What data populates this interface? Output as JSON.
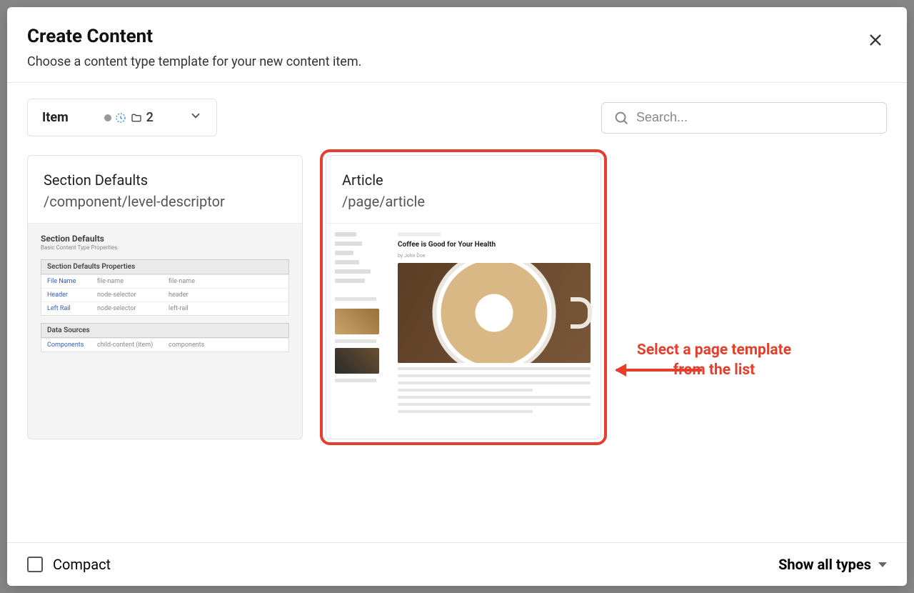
{
  "modal": {
    "title": "Create Content",
    "subtitle": "Choose a content type template for your new content item."
  },
  "toolbar": {
    "item_label": "Item",
    "item_count": "2",
    "search_placeholder": "Search..."
  },
  "cards": [
    {
      "title": "Section Defaults",
      "path": "/component/level-descriptor",
      "preview": {
        "heading": "Section Defaults",
        "sub": "Basic Content Type Properties",
        "section1": "Section Defaults Properties",
        "rows": [
          {
            "c1": "File Name",
            "c2": "file-name",
            "c3": "file-name"
          },
          {
            "c1": "Header",
            "c2": "node-selector",
            "c3": "header"
          },
          {
            "c1": "Left Rail",
            "c2": "node-selector",
            "c3": "left-rail"
          }
        ],
        "section2": "Data Sources",
        "rows2": [
          {
            "c1": "Components",
            "c2": "child-content (item)",
            "c3": "components"
          }
        ]
      }
    },
    {
      "title": "Article",
      "path": "/page/article",
      "preview": {
        "article_title": "Coffee is Good for Your Health",
        "byline": "by John Doe"
      }
    }
  ],
  "annotation": {
    "line1": "Select a page template",
    "line2": "from the list"
  },
  "footer": {
    "compact_label": "Compact",
    "show_all_label": "Show all types"
  }
}
